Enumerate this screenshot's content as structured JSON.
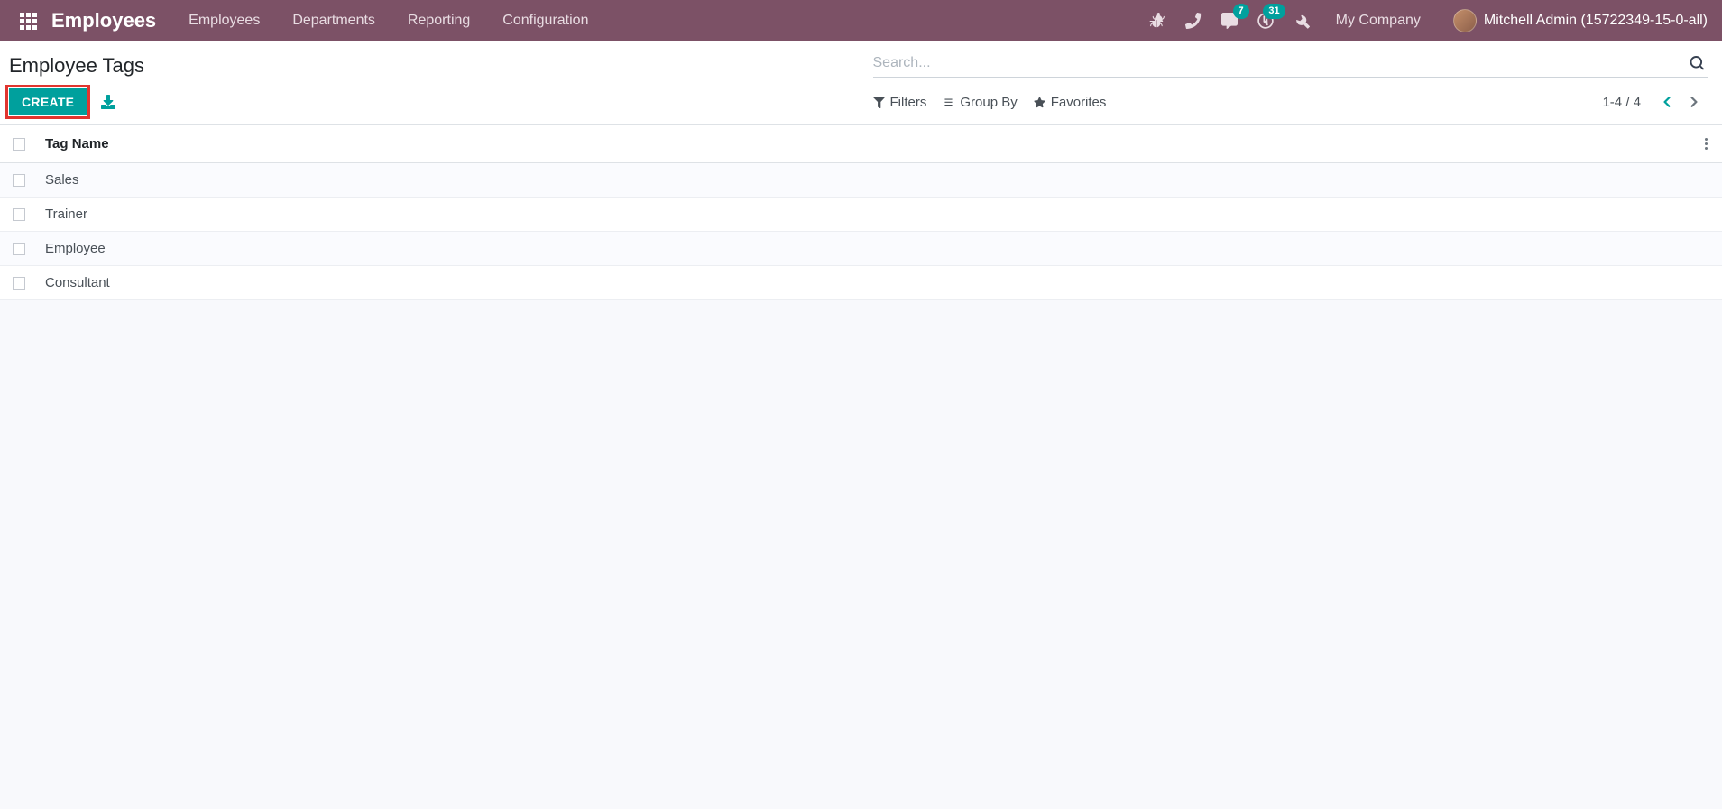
{
  "navbar": {
    "brand": "Employees",
    "menu": [
      {
        "label": "Employees"
      },
      {
        "label": "Departments"
      },
      {
        "label": "Reporting"
      },
      {
        "label": "Configuration"
      }
    ],
    "messages_badge": "7",
    "activities_badge": "31",
    "company": "My Company",
    "user": "Mitchell Admin (15722349-15-0-all)"
  },
  "control": {
    "title": "Employee Tags",
    "create_label": "CREATE",
    "search_placeholder": "Search...",
    "filters_label": "Filters",
    "groupby_label": "Group By",
    "favorites_label": "Favorites",
    "pager": "1-4 / 4"
  },
  "table": {
    "header": "Tag Name",
    "rows": [
      {
        "name": "Sales"
      },
      {
        "name": "Trainer"
      },
      {
        "name": "Employee"
      },
      {
        "name": "Consultant"
      }
    ]
  }
}
